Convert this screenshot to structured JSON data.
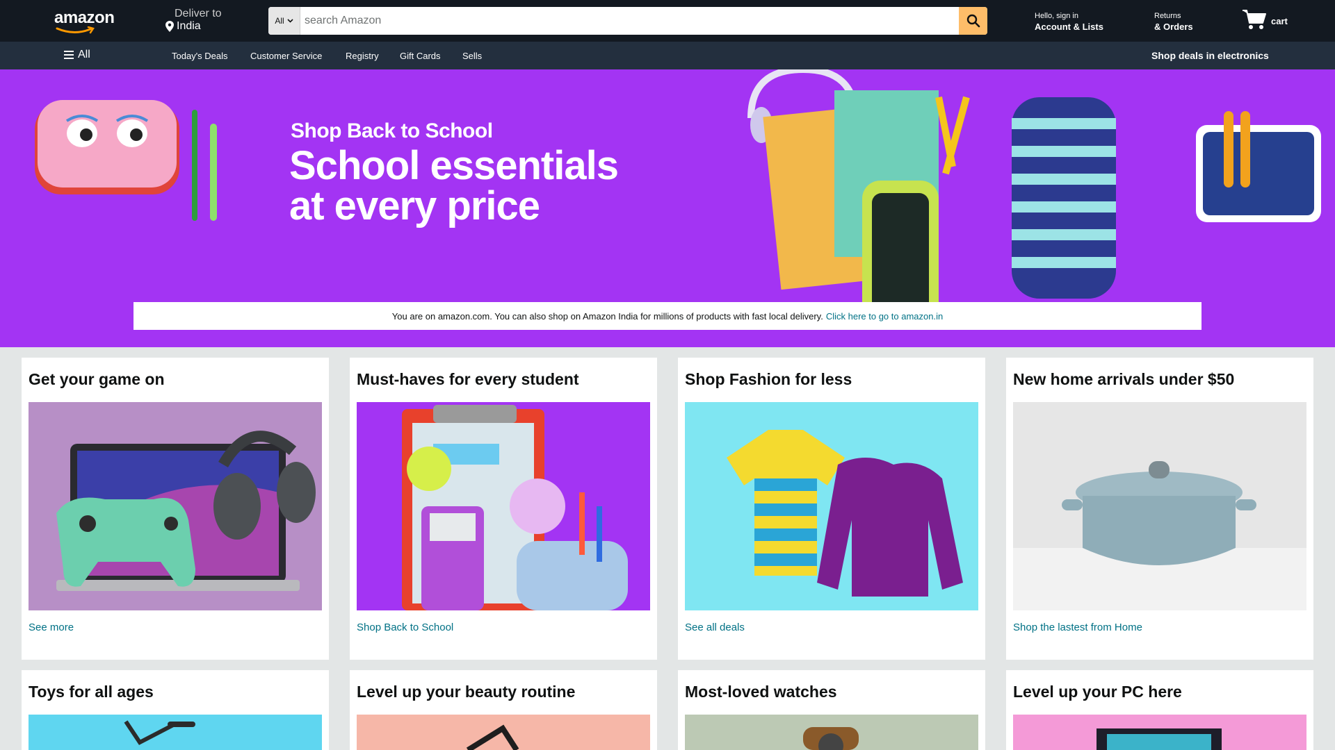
{
  "header": {
    "logo_text": "amazon",
    "deliver_label": "Deliver to",
    "deliver_location": "India",
    "search_category": "All",
    "search_placeholder": "search Amazon",
    "account_greeting": "Hello, sign in",
    "account_label": "Account & Lists",
    "returns_label": "Returns",
    "orders_label": "& Orders",
    "cart_label": "cart"
  },
  "subnav": {
    "all_label": "All",
    "items": [
      "Today's Deals",
      "Customer Service",
      "Registry",
      "Gift Cards",
      "Sells"
    ],
    "promo": "Shop deals in electronics"
  },
  "hero": {
    "kicker": "Shop Back to School",
    "title": "School essentials at every price",
    "notice_text": "You are on amazon.com. You can also shop on Amazon India for millions of products with fast local delivery.",
    "notice_link": "Click here to go to amazon.in"
  },
  "cards": [
    {
      "title": "Get your game on",
      "link": "See more"
    },
    {
      "title": "Must-haves for every student",
      "link": "Shop Back to School"
    },
    {
      "title": "Shop Fashion for less",
      "link": "See all deals"
    },
    {
      "title": "New home arrivals under $50",
      "link": "Shop the lastest from Home"
    },
    {
      "title": "Toys for all ages",
      "link": ""
    },
    {
      "title": "Level up your beauty routine",
      "link": ""
    },
    {
      "title": "Most-loved watches",
      "link": ""
    },
    {
      "title": "Level up your PC here",
      "link": ""
    }
  ],
  "colors": {
    "topnav": "#131921",
    "subnav": "#232f3e",
    "hero": "#a334f3",
    "search_button": "#febd69",
    "link": "#007185"
  },
  "icons": {
    "logo_smile": "amazon-smile-icon",
    "location": "location-pin-icon",
    "search": "search-icon",
    "cart": "cart-icon",
    "menu": "hamburger-menu-icon",
    "dropdown": "chevron-down-icon"
  }
}
